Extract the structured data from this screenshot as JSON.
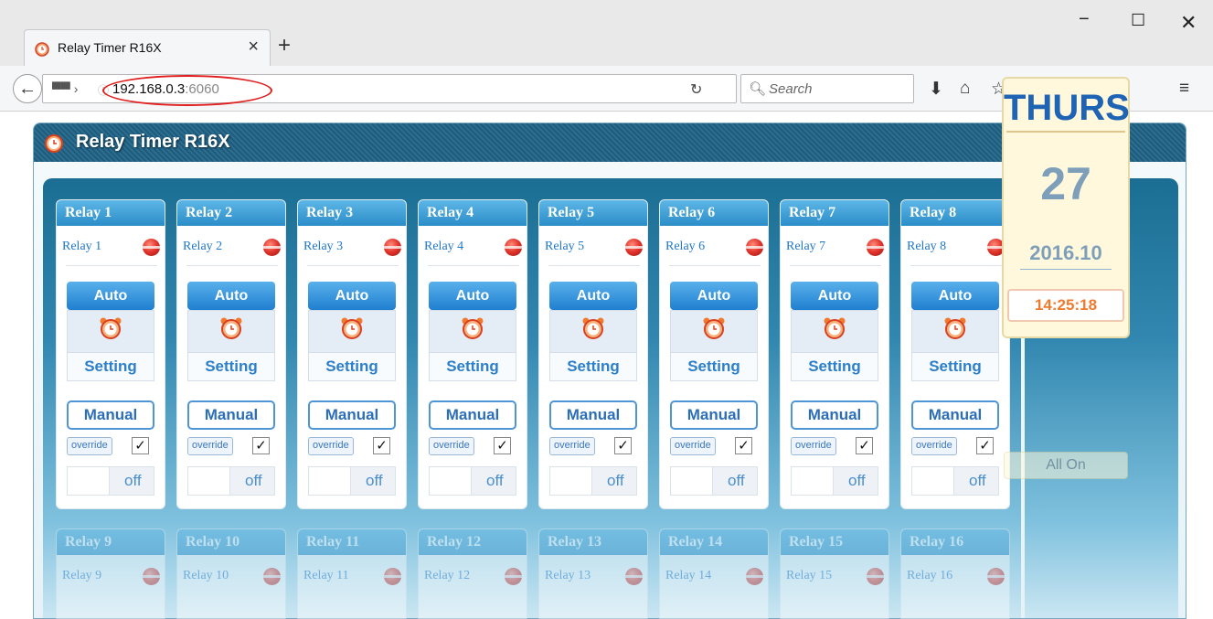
{
  "browser": {
    "tab_title": "Relay Timer R16X",
    "tab_close": "×",
    "new_tab": "+",
    "url_host": "192.168.0.3",
    "url_port": ":6060",
    "search_placeholder": "Search",
    "window_controls": {
      "minimize": "−",
      "maximize": "☐",
      "close": "✕"
    }
  },
  "app": {
    "title": "Relay Timer R16X",
    "relays": [
      {
        "header": "Relay 1",
        "name": "Relay 1",
        "auto": "Auto",
        "setting": "Setting",
        "manual": "Manual",
        "override": "override",
        "checked": "✓",
        "state": "off"
      },
      {
        "header": "Relay 2",
        "name": "Relay 2",
        "auto": "Auto",
        "setting": "Setting",
        "manual": "Manual",
        "override": "override",
        "checked": "✓",
        "state": "off"
      },
      {
        "header": "Relay 3",
        "name": "Relay 3",
        "auto": "Auto",
        "setting": "Setting",
        "manual": "Manual",
        "override": "override",
        "checked": "✓",
        "state": "off"
      },
      {
        "header": "Relay 4",
        "name": "Relay 4",
        "auto": "Auto",
        "setting": "Setting",
        "manual": "Manual",
        "override": "override",
        "checked": "✓",
        "state": "off"
      },
      {
        "header": "Relay 5",
        "name": "Relay 5",
        "auto": "Auto",
        "setting": "Setting",
        "manual": "Manual",
        "override": "override",
        "checked": "✓",
        "state": "off"
      },
      {
        "header": "Relay 6",
        "name": "Relay 6",
        "auto": "Auto",
        "setting": "Setting",
        "manual": "Manual",
        "override": "override",
        "checked": "✓",
        "state": "off"
      },
      {
        "header": "Relay 7",
        "name": "Relay 7",
        "auto": "Auto",
        "setting": "Setting",
        "manual": "Manual",
        "override": "override",
        "checked": "✓",
        "state": "off"
      },
      {
        "header": "Relay 8",
        "name": "Relay 8",
        "auto": "Auto",
        "setting": "Setting",
        "manual": "Manual",
        "override": "override",
        "checked": "✓",
        "state": "off"
      }
    ],
    "relays_lower": [
      {
        "header": "Relay 9",
        "name": "Relay 9"
      },
      {
        "header": "Relay 10",
        "name": "Relay 10"
      },
      {
        "header": "Relay 11",
        "name": "Relay 11"
      },
      {
        "header": "Relay 12",
        "name": "Relay 12"
      },
      {
        "header": "Relay 13",
        "name": "Relay 13"
      },
      {
        "header": "Relay 14",
        "name": "Relay 14"
      },
      {
        "header": "Relay 15",
        "name": "Relay 15"
      },
      {
        "header": "Relay 16",
        "name": "Relay 16"
      }
    ],
    "date": {
      "day": "THURS",
      "date": "27",
      "year_month": "2016.10",
      "time": "14:25:18"
    },
    "all_on": "All On"
  },
  "colors": {
    "accent": "#2b8dc8",
    "led_off": "#e0322a",
    "time": "#f07a2e",
    "header_bg": "#215b7a"
  }
}
